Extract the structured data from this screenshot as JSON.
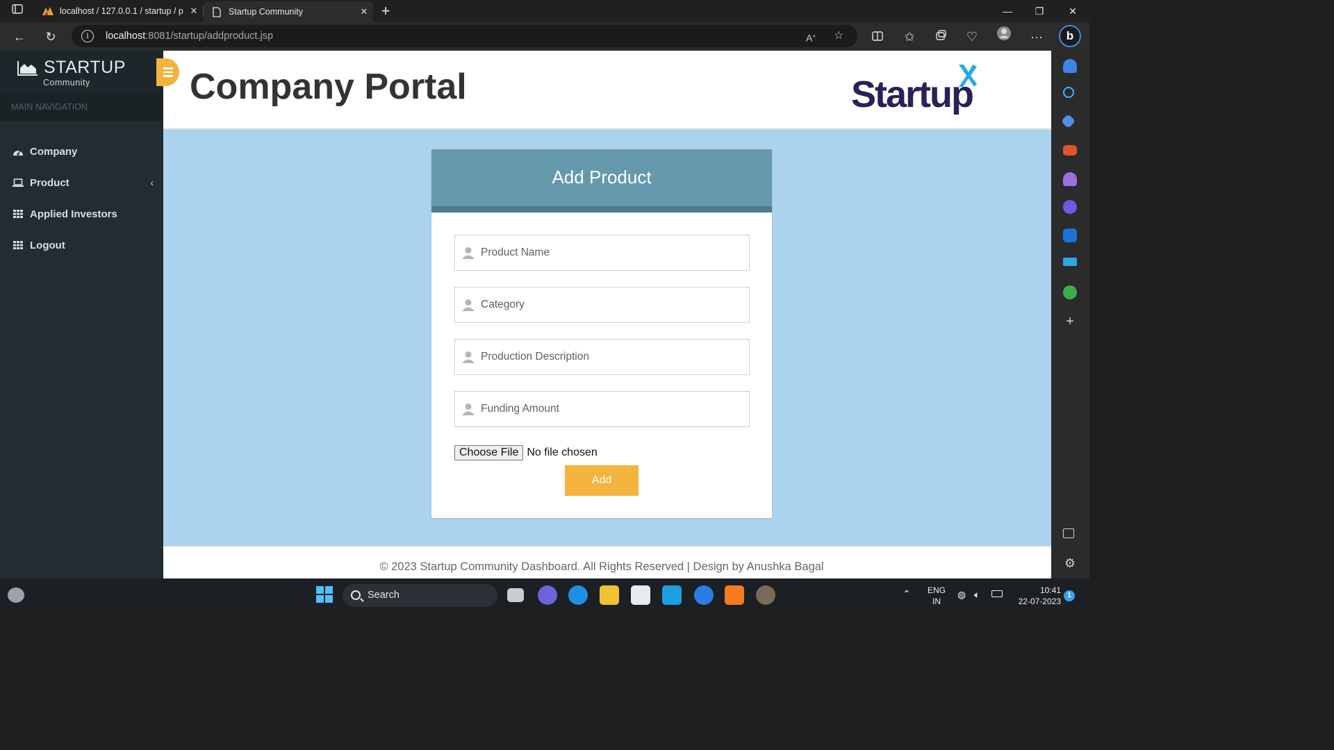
{
  "browser": {
    "tabs": [
      {
        "title": "localhost / 127.0.0.1 / startup / p",
        "active": false
      },
      {
        "title": "Startup Community",
        "active": true
      }
    ],
    "address": {
      "host": "localhost",
      "path": ":8081/startup/addproduct.jsp"
    },
    "bing_label": "b"
  },
  "app": {
    "brand": {
      "name": "STARTUP",
      "subtitle": "Community"
    },
    "nav_header": "MAIN NAVIGATION",
    "nav": [
      {
        "label": "Company",
        "icon": "dashboard-icon"
      },
      {
        "label": "Product",
        "icon": "laptop-icon",
        "chevron": "‹"
      },
      {
        "label": "Applied Investors",
        "icon": "grid-icon"
      },
      {
        "label": "Logout",
        "icon": "grid-icon"
      }
    ],
    "page_title": "Company Portal",
    "logo_text": "Startup",
    "form": {
      "heading": "Add Product",
      "fields": [
        {
          "placeholder": "Product Name"
        },
        {
          "placeholder": "Category"
        },
        {
          "placeholder": "Production Description"
        },
        {
          "placeholder": "Funding Amount"
        }
      ],
      "file_button": "Choose File",
      "file_status": "No file chosen",
      "submit_label": "Add"
    },
    "footer": "© 2023 Startup Community Dashboard. All Rights Reserved | Design by Anushka Bagal",
    "colors": {
      "accent": "#f3b33d",
      "card_header": "#6499ab",
      "content_bg": "#acd3ee",
      "sidebar_bg": "#222d32"
    }
  },
  "taskbar": {
    "search_label": "Search",
    "language": {
      "line1": "ENG",
      "line2": "IN"
    },
    "clock": {
      "time": "10:41",
      "date": "22-07-2023"
    },
    "notification_count": "1"
  }
}
